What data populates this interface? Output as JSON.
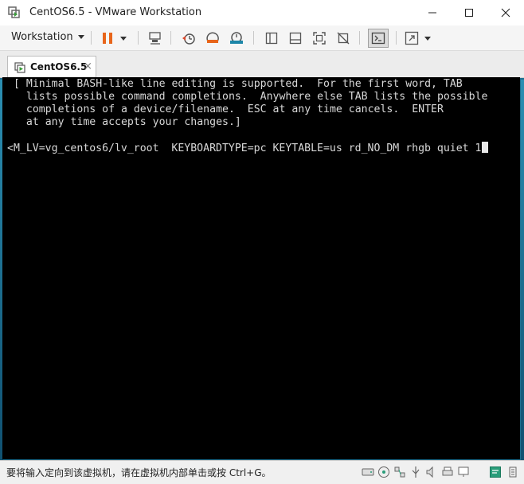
{
  "window": {
    "title": "CentOS6.5 - VMware Workstation"
  },
  "toolbar": {
    "workstation_menu_label": "Workstation"
  },
  "tabs": [
    {
      "label": "CentOS6.5",
      "close_glyph": "×"
    }
  ],
  "console": {
    "lines": [
      "[ Minimal BASH-like line editing is supported.  For the first word, TAB",
      "  lists possible command completions.  Anywhere else TAB lists the possible",
      "  completions of a device/filename.  ESC at any time cancels.  ENTER",
      "  at any time accepts your changes.]",
      "<M_LV=vg_centos6/lv_root  KEYBOARDTYPE=pc KEYTABLE=us rd_NO_DM rhgb quiet 1"
    ]
  },
  "statusbar": {
    "message": "要将输入定向到该虚拟机，请在虚拟机内部单击或按 Ctrl+G。"
  },
  "icons": {
    "app": "vmware-logo-icon",
    "minimize": "minimize-icon",
    "maximize": "maximize-icon",
    "close": "close-icon",
    "pause": "pause-icon",
    "send_keys": "send-ctrl-alt-del-icon",
    "snapshot": "snapshot-icon",
    "revert_snapshot": "revert-snapshot-icon",
    "snapshot_manager": "snapshot-manager-icon",
    "library": "library-view-icon",
    "thumbnail": "thumbnail-bar-icon",
    "fullscreen": "full-screen-icon",
    "unity": "unity-icon",
    "console_view": "console-view-icon",
    "stretch": "stretch-guest-icon"
  },
  "colors": {
    "pause_orange": "#e8651b",
    "snapshot_red": "#d9472b",
    "snapshot_teal": "#1c86a8",
    "console_bg": "#000000",
    "status_accent": "#2a9d7a"
  }
}
